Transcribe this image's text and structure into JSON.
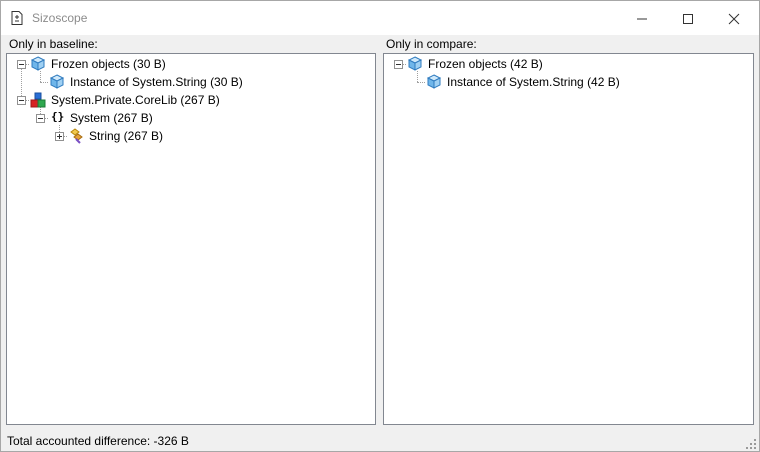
{
  "window": {
    "title": "Sizoscope"
  },
  "left_panel": {
    "label": "Only in baseline:",
    "nodes": [
      {
        "text": "Frozen objects (30 B)",
        "icon": "cube-icon"
      },
      {
        "text": "Instance of System.String (30 B)",
        "icon": "cube-icon"
      },
      {
        "text": "System.Private.CoreLib (267 B)",
        "icon": "assembly-icon"
      },
      {
        "text": "System (267 B)",
        "icon": "namespace-braces-icon"
      },
      {
        "text": "String (267 B)",
        "icon": "class-icon"
      }
    ]
  },
  "right_panel": {
    "label": "Only in compare:",
    "nodes": [
      {
        "text": "Frozen objects (42 B)",
        "icon": "cube-icon"
      },
      {
        "text": "Instance of System.String (42 B)",
        "icon": "cube-icon"
      }
    ]
  },
  "status": {
    "text": "Total accounted difference: -326 B"
  },
  "colors": {
    "window_bg": "#f0f0f0",
    "tree_border": "#828790",
    "title_text": "#8c8c8c"
  }
}
